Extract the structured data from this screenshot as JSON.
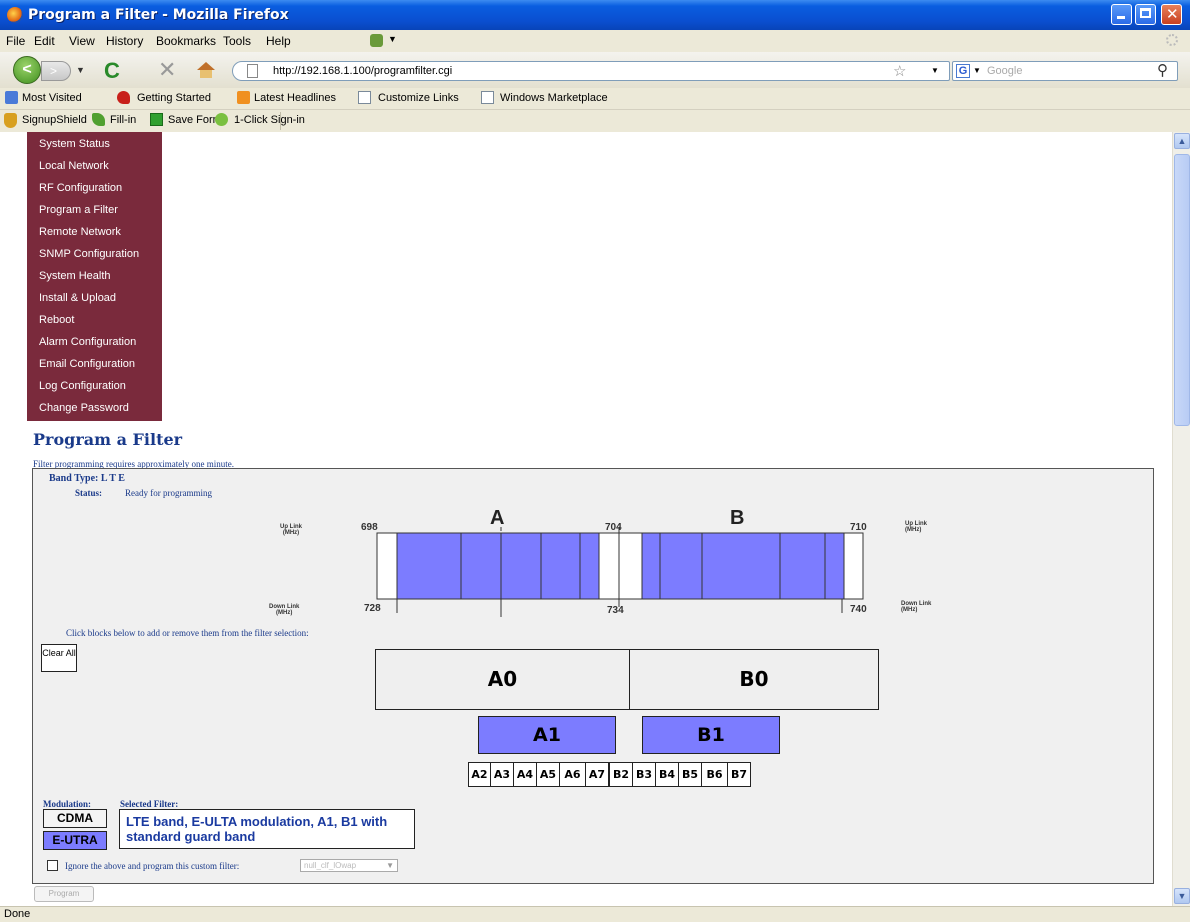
{
  "window": {
    "title": "Program a Filter - Mozilla Firefox"
  },
  "menu": [
    "File",
    "Edit",
    "View",
    "History",
    "Bookmarks",
    "Tools",
    "Help"
  ],
  "address": {
    "url": "http://192.168.1.100/programfilter.cgi"
  },
  "search": {
    "engine_letter": "G",
    "placeholder": "Google"
  },
  "bookmarks": [
    "Most Visited",
    "Getting Started",
    "Latest Headlines",
    "Customize Links",
    "Windows Marketplace"
  ],
  "addons": [
    "SignupShield",
    "Fill-in",
    "Save Form",
    "1-Click Sign-in"
  ],
  "sidebar": {
    "items": [
      "System Status",
      "Local Network",
      "RF Configuration",
      "Program a Filter",
      "Remote Network",
      "SNMP Configuration",
      "System Health",
      "Install & Upload",
      "Reboot",
      "Alarm Configuration",
      "Email Configuration",
      "Log Configuration",
      "Change Password"
    ]
  },
  "page": {
    "title": "Program a Filter",
    "note": "Filter programming requires approximately one minute.",
    "band_type": "Band Type: L T E",
    "status_label": "Status:",
    "status_value": "Ready for programming",
    "diagram": {
      "uplink_left": "Up Link\n(MHz)",
      "uplink_right": "Up Link\n(MHz)",
      "downlink_left": "Down Link\n(MHz)",
      "downlink_right": "Down Link\n(MHz)",
      "up_698": "698",
      "up_704": "704",
      "up_710": "710",
      "down_728": "728",
      "down_734": "734",
      "down_740": "740",
      "label_a": "A",
      "label_b": "B"
    },
    "click_hint": "Click blocks below to add or remove them from the filter selection:",
    "clear_all": "Clear All",
    "blocks": {
      "a0": "A0",
      "b0": "B0",
      "a1": "A1",
      "b1": "B1",
      "small": [
        "A2",
        "A3",
        "A4",
        "A5",
        "A6",
        "A7",
        "B2",
        "B3",
        "B4",
        "B5",
        "B6",
        "B7"
      ]
    },
    "modulation_label": "Modulation:",
    "selected_label": "Selected Filter:",
    "mod_cdma": "CDMA",
    "mod_eutra": "E-UTRA",
    "selected_filter": "LTE band, E-ULTA modulation, A1, B1 with standard guard band",
    "ignore_label": "Ignore the above and program this custom filter:",
    "custom_select": "null_clf_lOwap",
    "program_button": "Program"
  },
  "status": {
    "text": "Done"
  },
  "colors": {
    "selected": "#7c7cff",
    "sidebar": "#7a2a3c",
    "title": "#1a3a8a"
  }
}
